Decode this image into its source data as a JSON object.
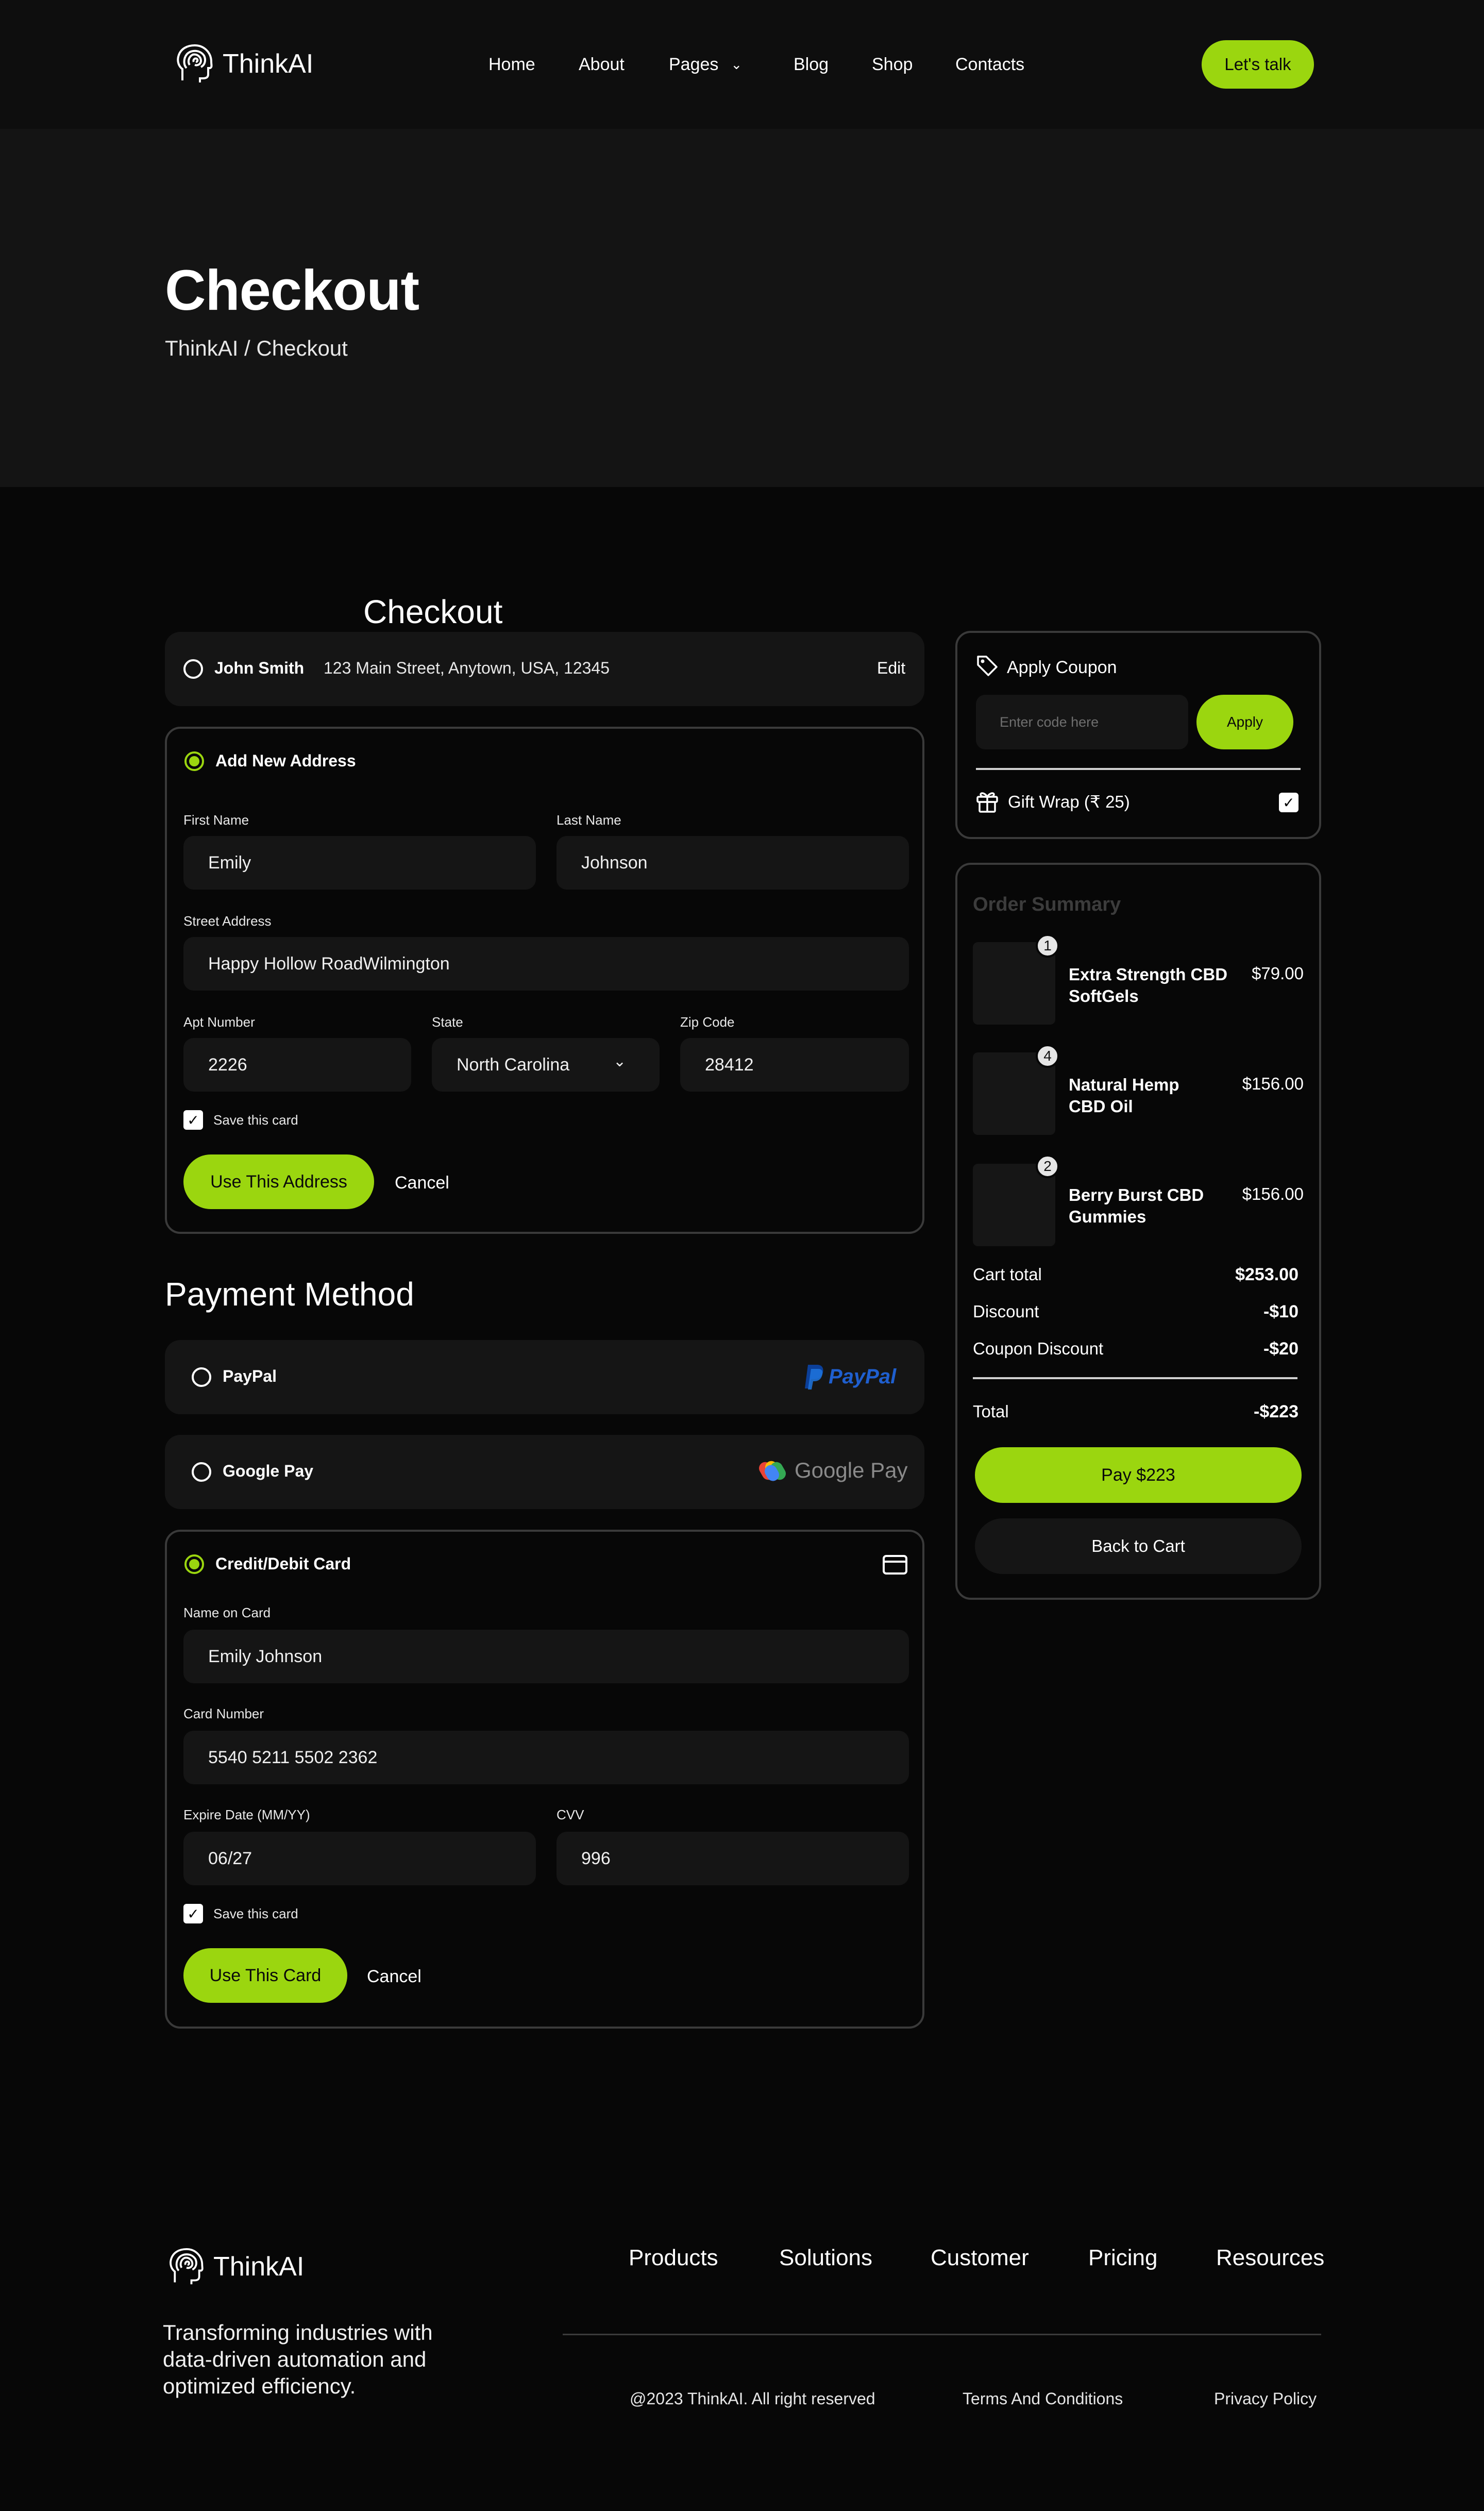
{
  "header": {
    "brand": "ThinkAI",
    "nav": [
      "Home",
      "About",
      "Pages",
      "Blog",
      "Shop",
      "Contacts"
    ],
    "cta": "Let's talk"
  },
  "hero": {
    "title": "Checkout",
    "breadcrumb": "ThinkAI / Checkout"
  },
  "checkout": {
    "heading": "Checkout",
    "saved_address": {
      "name": "John Smith",
      "address": "123 Main Street, Anytown, USA, 12345",
      "edit": "Edit"
    },
    "new_address": {
      "title": "Add New Address",
      "first_name_label": "First Name",
      "first_name_value": "Emily",
      "last_name_label": "Last Name",
      "last_name_value": "Johnson",
      "street_label": "Street Address",
      "street_value": "Happy Hollow RoadWilmington",
      "apt_label": "Apt Number",
      "apt_value": "2226",
      "state_label": "State",
      "state_value": "North Carolina",
      "zip_label": "Zip Code",
      "zip_value": "28412",
      "save_label": "Save this card",
      "use_button": "Use This Address",
      "cancel": "Cancel"
    }
  },
  "payment": {
    "heading": "Payment Method",
    "paypal": {
      "label": "PayPal",
      "logo_text": "PayPal"
    },
    "gpay": {
      "label": "Google Pay",
      "logo_text": "Google Pay"
    },
    "card": {
      "title": "Credit/Debit Card",
      "name_label": "Name on Card",
      "name_value": "Emily Johnson",
      "number_label": "Card Number",
      "number_value": "5540 5211 5502 2362",
      "expiry_label": "Expire Date (MM/YY)",
      "expiry_value": "06/27",
      "cvv_label": "CVV",
      "cvv_value": "996",
      "save_label": "Save this card",
      "use_button": "Use This Card",
      "cancel": "Cancel"
    }
  },
  "coupon": {
    "title": "Apply Coupon",
    "placeholder": "Enter code here",
    "apply": "Apply",
    "gift_wrap": "Gift Wrap (₹ 25)"
  },
  "summary": {
    "title": "Order Summary",
    "items": [
      {
        "qty": "1",
        "name_line1": "Extra Strength CBD",
        "name_line2": "SoftGels",
        "price": "$79.00"
      },
      {
        "qty": "4",
        "name_line1": "Natural Hemp",
        "name_line2": "CBD Oil",
        "price": "$156.00"
      },
      {
        "qty": "2",
        "name_line1": "Berry Burst CBD",
        "name_line2": "Gummies",
        "price": "$156.00"
      }
    ],
    "cart_total_label": "Cart total",
    "cart_total": "$253.00",
    "discount_label": "Discount",
    "discount": "-$10",
    "coupon_label": "Coupon Discount",
    "coupon_discount": "-$20",
    "total_label": "Total",
    "total": "-$223",
    "pay_button": "Pay $223",
    "back_button": "Back to Cart"
  },
  "footer": {
    "brand": "ThinkAI",
    "tagline_1": "Transforming industries with",
    "tagline_2": "data-driven automation and",
    "tagline_3": "optimized efficiency.",
    "nav": [
      "Products",
      "Solutions",
      "Customer",
      "Pricing",
      "Resources"
    ],
    "copyright": "@2023 ThinkAI. All right reserved",
    "terms": "Terms And Conditions",
    "privacy": "Privacy Policy"
  },
  "colors": {
    "accent": "#9bd60f",
    "background": "#070707",
    "panel": "#151515",
    "hero": "#141414"
  },
  "icons": [
    "head-logo-icon",
    "chevron-down-icon",
    "tag-icon",
    "gift-icon",
    "credit-card-icon",
    "check-icon",
    "paypal-logo",
    "google-pay-logo"
  ]
}
